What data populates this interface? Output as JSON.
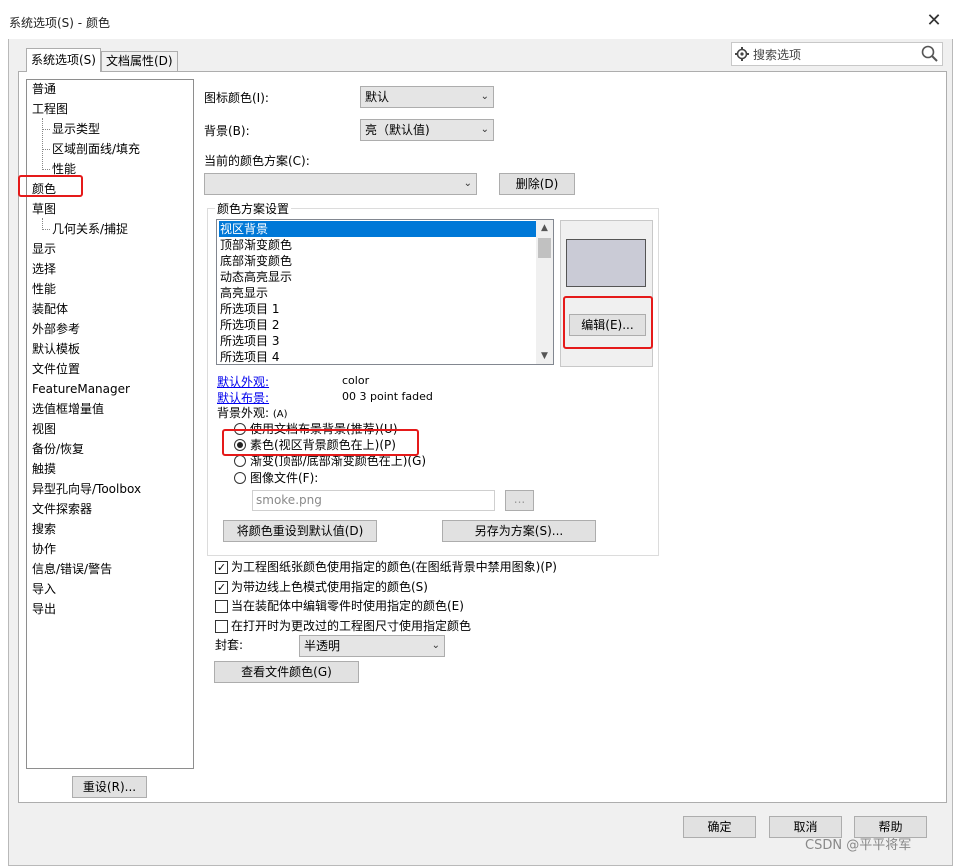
{
  "window": {
    "title": "系统选项(S) - 颜色",
    "close_glyph": "✕"
  },
  "tabs": [
    {
      "label": "系统选项(S)",
      "active": true
    },
    {
      "label": "文档属性(D)",
      "active": false
    }
  ],
  "search": {
    "placeholder": "搜索选项"
  },
  "tree": {
    "items": [
      {
        "label": "普通",
        "indent": 0
      },
      {
        "label": "工程图",
        "indent": 0
      },
      {
        "label": "显示类型",
        "indent": 1
      },
      {
        "label": "区域剖面线/填充",
        "indent": 1
      },
      {
        "label": "性能",
        "indent": 1
      },
      {
        "label": "颜色",
        "indent": 0,
        "selected": true
      },
      {
        "label": "草图",
        "indent": 0
      },
      {
        "label": "几何关系/捕捉",
        "indent": 1
      },
      {
        "label": "显示",
        "indent": 0
      },
      {
        "label": "选择",
        "indent": 0
      },
      {
        "label": "性能",
        "indent": 0
      },
      {
        "label": "装配体",
        "indent": 0
      },
      {
        "label": "外部参考",
        "indent": 0
      },
      {
        "label": "默认模板",
        "indent": 0
      },
      {
        "label": "文件位置",
        "indent": 0
      },
      {
        "label": "FeatureManager",
        "indent": 0
      },
      {
        "label": "选值框增量值",
        "indent": 0
      },
      {
        "label": "视图",
        "indent": 0
      },
      {
        "label": "备份/恢复",
        "indent": 0
      },
      {
        "label": "触摸",
        "indent": 0
      },
      {
        "label": "异型孔向导/Toolbox",
        "indent": 0
      },
      {
        "label": "文件探索器",
        "indent": 0
      },
      {
        "label": "搜索",
        "indent": 0
      },
      {
        "label": "协作",
        "indent": 0
      },
      {
        "label": "信息/错误/警告",
        "indent": 0
      },
      {
        "label": "导入",
        "indent": 0
      },
      {
        "label": "导出",
        "indent": 0
      }
    ]
  },
  "reset_button": "重设(R)...",
  "icon_color": {
    "label": "图标颜色(I):",
    "value": "默认"
  },
  "background": {
    "label": "背景(B):",
    "value": "亮（默认值)"
  },
  "scheme": {
    "label": "当前的颜色方案(C):",
    "value": "",
    "delete_label": "删除(D)"
  },
  "scheme_settings": {
    "group_label": "颜色方案设置",
    "items": [
      "视区背景",
      "顶部渐变颜色",
      "底部渐变颜色",
      "动态高亮显示",
      "高亮显示",
      "所选项目 1",
      "所选项目 2",
      "所选项目 3",
      "所选项目 4"
    ],
    "selected_index": 0,
    "swatch_color": "#cacbd6",
    "edit_label": "编辑(E)...",
    "default_appearance_link": "默认外观:",
    "default_appearance_value": "color",
    "default_scene_link": "默认布景:",
    "default_scene_value": "00 3 point faded",
    "bg_appearance_label": "背景外观:",
    "bg_appearance_suffix": "(A)",
    "radios": [
      {
        "label": "使用文档布景背景(推荐)(U)",
        "checked": false
      },
      {
        "label": "素色(视区背景颜色在上)(P)",
        "checked": true
      },
      {
        "label": "渐变(顶部/底部渐变颜色在上)(G)",
        "checked": false
      },
      {
        "label": "图像文件(F):",
        "checked": false
      }
    ],
    "image_file": "smoke.png",
    "browse_label": "...",
    "reset_colors_label": "将颜色重设到默认值(D)",
    "save_scheme_label": "另存为方案(S)..."
  },
  "checkboxes": [
    {
      "label": "为工程图纸张颜色使用指定的颜色(在图纸背景中禁用图象)(P)",
      "checked": true
    },
    {
      "label": "为带边线上色模式使用指定的颜色(S)",
      "checked": true
    },
    {
      "label": "当在装配体中编辑零件时使用指定的颜色(E)",
      "checked": false
    },
    {
      "label": "在打开时为更改过的工程图尺寸使用指定颜色",
      "checked": false
    }
  ],
  "envelope": {
    "label": "封套:",
    "value": "半透明"
  },
  "view_doc_colors": "查看文件颜色(G)",
  "footer": {
    "ok": "确定",
    "cancel": "取消",
    "help": "帮助"
  },
  "watermark": "CSDN @平平将军",
  "highlight_color": "#e51a1a"
}
